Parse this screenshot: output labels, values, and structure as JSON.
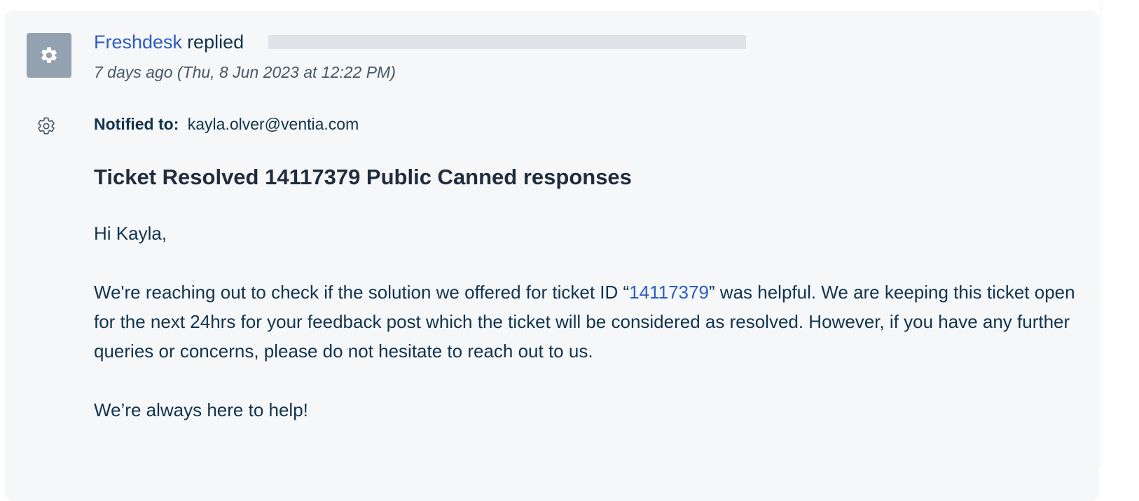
{
  "conversation": {
    "sender": "Freshdesk",
    "action": "replied",
    "timestamp": "7 days ago (Thu, 8 Jun 2023 at 12:22 PM)",
    "notified_label": "Notified to:",
    "notified_email": "kayla.olver@ventia.com",
    "subject": "Ticket Resolved 14117379 Public Canned responses",
    "greeting": "Hi Kayla,",
    "para1_before": "We're reaching out to check if the solution we offered for ticket ID “",
    "ticket_id": "14117379",
    "para1_after": "” was helpful. We are keeping this ticket open for the next 24hrs for your feedback post which the ticket will be considered as resolved. However, if you have any further queries or concerns, please do not hesitate to reach out to us.",
    "closing": "We’re always here to help!"
  },
  "icons": {
    "avatar": "gear-icon",
    "side": "gear-outline-icon"
  },
  "colors": {
    "link": "#2c5cc5",
    "avatar_bg": "#92a2b1",
    "card_bg": "#f5f7f9"
  }
}
